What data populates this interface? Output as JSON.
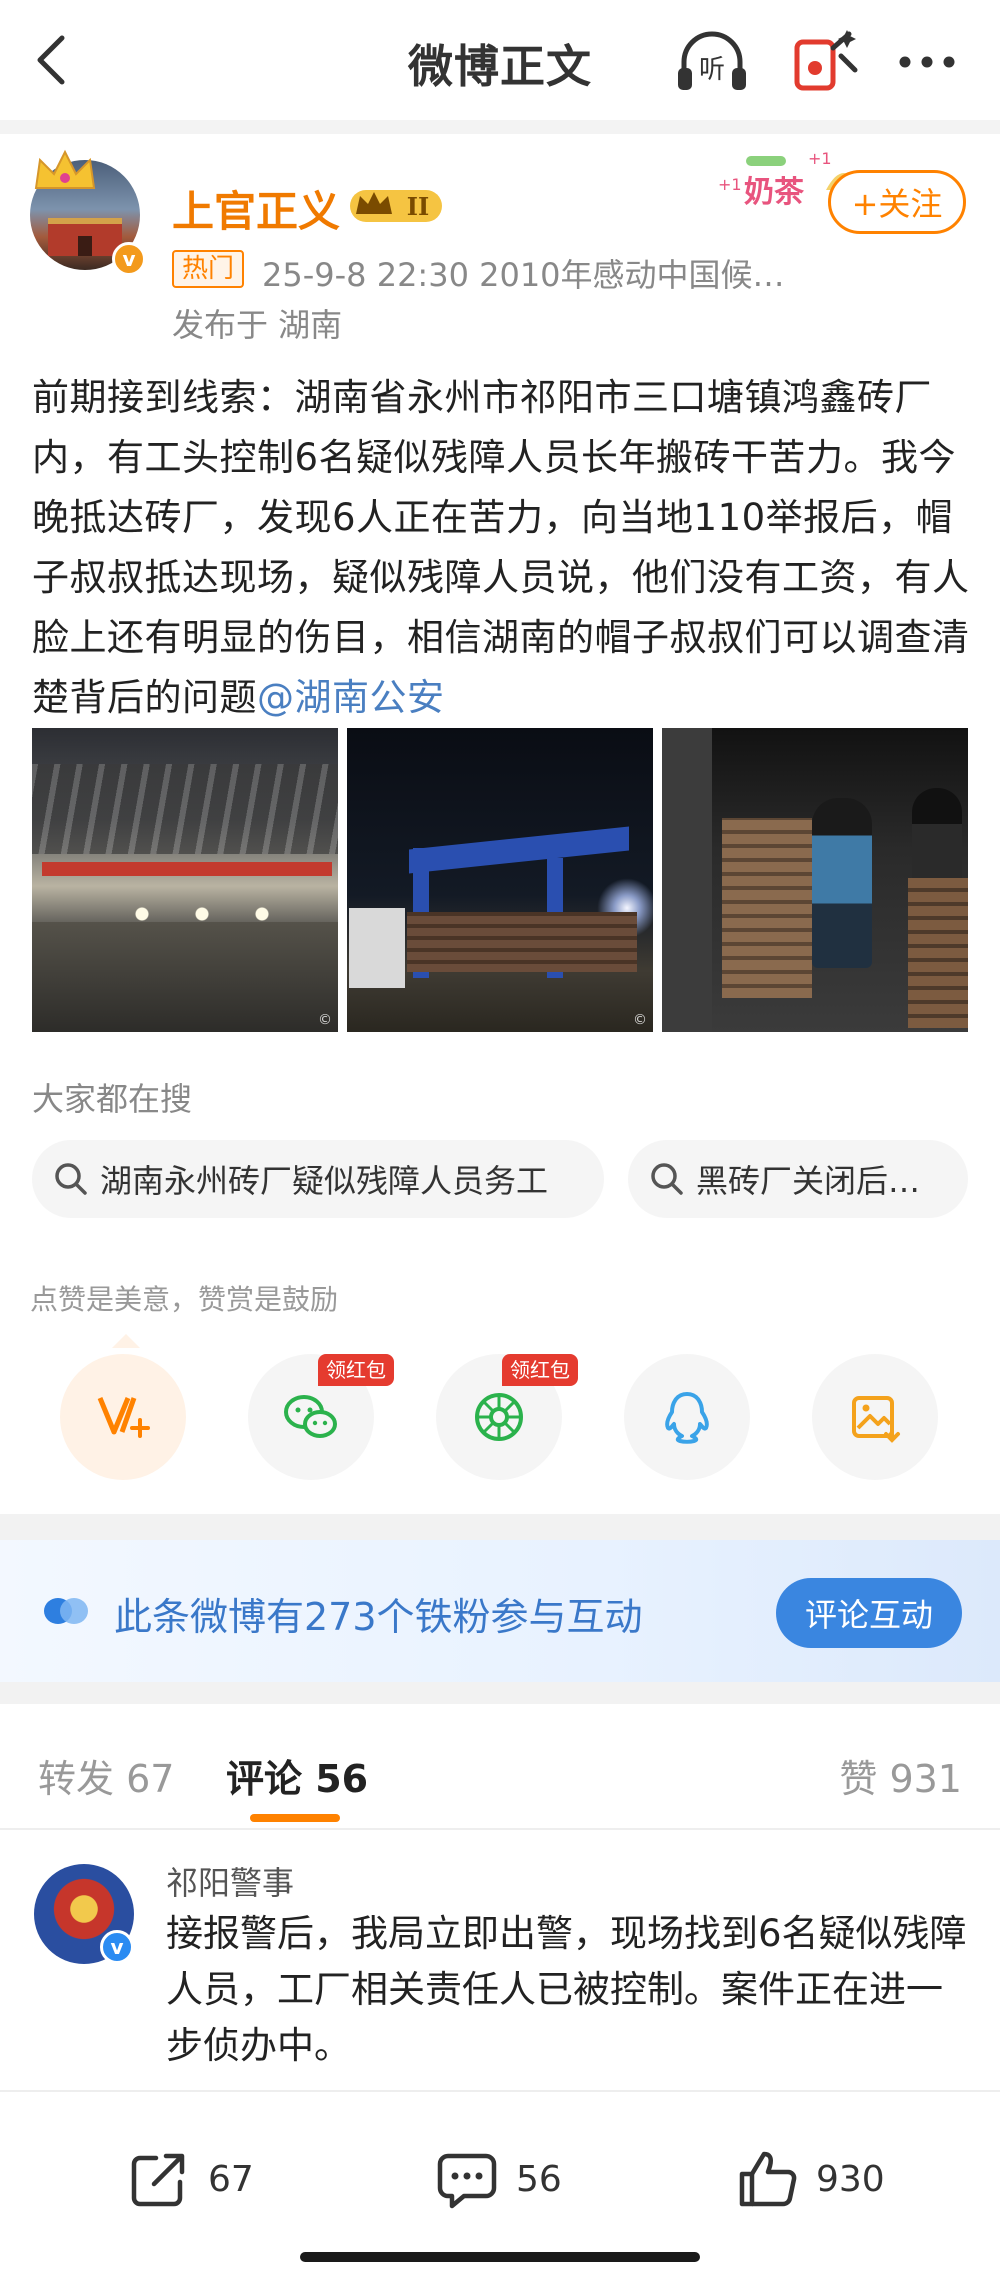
{
  "header": {
    "title": "微博正文",
    "back_icon": "chevron-left-icon",
    "listen_label": "听",
    "gift_icon": "red-envelope-icon",
    "more_icon": "more-dots-icon"
  },
  "author": {
    "name": "上官正义",
    "level_badge": "II",
    "hot_tag": "热门",
    "meta": "25-9-8 22:30  2010年感动中国候…",
    "location": "发布于 湖南",
    "verified": "v",
    "sticker_text": "奶茶",
    "follow_label": "+关注"
  },
  "post": {
    "text": "前期接到线索：湖南省永州市祁阳市三口塘镇鸿鑫砖厂内，有工头控制6名疑似残障人员长年搬砖干苦力。我今晚抵达砖厂，发现6人正在苦力，向当地110举报后，帽子叔叔抵达现场，疑似残障人员说，他们没有工资，有人脸上还有明显的伤目，相信湖南的帽子叔叔们可以调查清楚背后的问题",
    "mention": "@湖南公安",
    "watermark": "©"
  },
  "search": {
    "title": "大家都在搜",
    "chips": [
      "湖南永州砖厂疑似残障人员务工",
      "黑砖厂关闭后…"
    ]
  },
  "reward": {
    "title": "点赞是美意，赞赏是鼓励",
    "red_packet_label": "领红包",
    "buttons": [
      "reward-v-icon",
      "wechat-icon",
      "moments-icon",
      "qq-icon",
      "save-image-icon"
    ]
  },
  "fans": {
    "text": "此条微博有273个铁粉参与互动",
    "button": "评论互动"
  },
  "tabs": {
    "repost": "转发 67",
    "comment": "评论 56",
    "likes": "赞 931"
  },
  "comment": {
    "name": "祁阳警事",
    "verified": "v",
    "text": "接报警后，我局立即出警，现场找到6名疑似残障人员，工厂相关责任人已被控制。案件正在进一步侦办中。"
  },
  "bottom": {
    "repost_count": "67",
    "comment_count": "56",
    "like_count": "930"
  },
  "colors": {
    "accent_orange": "#ff8200",
    "link_blue": "#4a7fc1",
    "fans_blue": "#3a86e0"
  }
}
